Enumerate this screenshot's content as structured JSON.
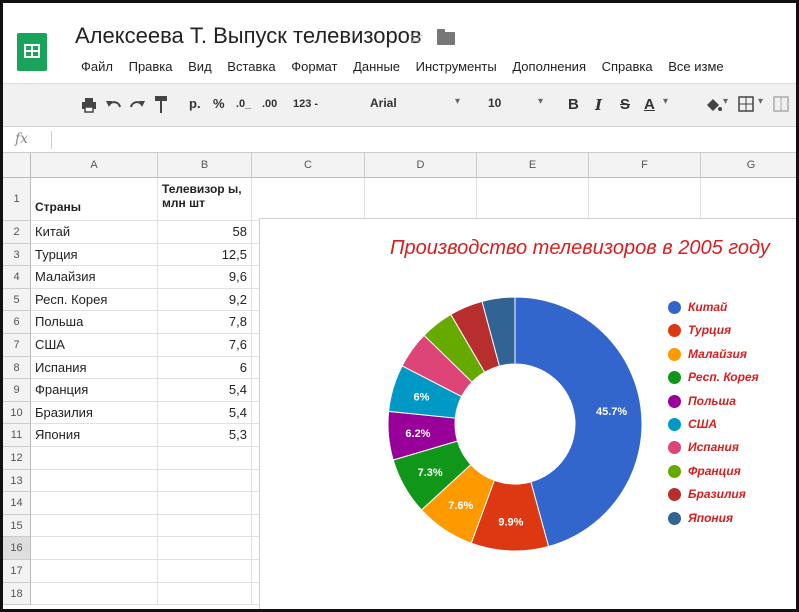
{
  "app": {
    "title": "Алексеева Т. Выпуск телевизоров",
    "star": "☆"
  },
  "menu": [
    "Файл",
    "Правка",
    "Вид",
    "Вставка",
    "Формат",
    "Данные",
    "Инструменты",
    "Дополнения",
    "Справка",
    "Все изме"
  ],
  "toolbar": {
    "currency": "р.",
    "percent": "%",
    "dec_less": ".0_",
    "dec_more": ".00",
    "number_format": "123 -",
    "font": "Arial",
    "font_size": "10",
    "bold": "B",
    "italic": "I",
    "strike": "S",
    "text_color": "A"
  },
  "formula_bar": {
    "fx": "fx",
    "value": ""
  },
  "columns": [
    "A",
    "B",
    "C",
    "D",
    "E",
    "F",
    "G"
  ],
  "rows": [
    "1",
    "2",
    "3",
    "4",
    "5",
    "6",
    "7",
    "8",
    "9",
    "10",
    "11",
    "12",
    "13",
    "14",
    "15",
    "16",
    "17",
    "18"
  ],
  "table": {
    "header": {
      "country": "Страны",
      "tv": "Телевизор ы, млн шт"
    },
    "data": [
      {
        "country": "Китай",
        "value": "58"
      },
      {
        "country": "Турция",
        "value": "12,5"
      },
      {
        "country": "Малайзия",
        "value": "9,6"
      },
      {
        "country": "Респ. Корея",
        "value": "9,2"
      },
      {
        "country": "Польша",
        "value": "7,8"
      },
      {
        "country": "США",
        "value": "7,6"
      },
      {
        "country": "Испания",
        "value": "6"
      },
      {
        "country": "Франция",
        "value": "5,4"
      },
      {
        "country": "Бразилия",
        "value": "5,4"
      },
      {
        "country": "Япония",
        "value": "5,3"
      }
    ]
  },
  "chart_data": {
    "type": "pie",
    "title": "Производство телевизоров в 2005 году",
    "categories": [
      "Китай",
      "Турция",
      "Малайзия",
      "Респ. Корея",
      "Польша",
      "США",
      "Испания",
      "Франция",
      "Бразилия",
      "Япония"
    ],
    "values": [
      58,
      12.5,
      9.6,
      9.2,
      7.8,
      7.6,
      6,
      5.4,
      5.4,
      5.3
    ],
    "colors": [
      "#3366cc",
      "#dc3912",
      "#ff9900",
      "#109618",
      "#990099",
      "#0099c6",
      "#dd4477",
      "#66aa00",
      "#b82e2e",
      "#316395"
    ],
    "data_labels": [
      "45.7%",
      "9.9%",
      "7.6%",
      "7.3%",
      "6.2%",
      "6%",
      "",
      "",
      "",
      ""
    ],
    "legend_position": "right",
    "donut": true
  }
}
